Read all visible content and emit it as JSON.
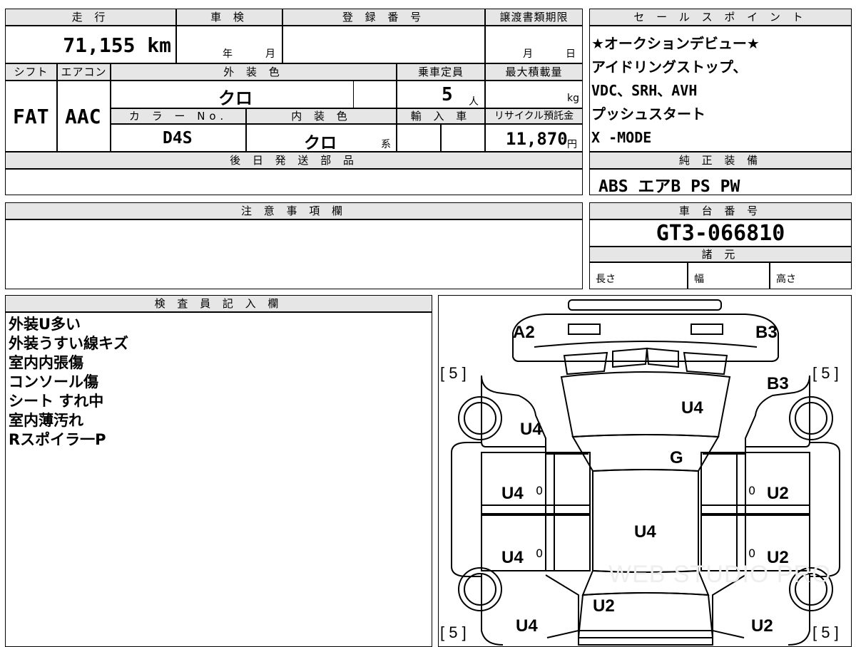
{
  "top": {
    "mileage_header": "走 行",
    "mileage_value": "71,155 km",
    "inspection_header": "車 検",
    "inspection_year": "年",
    "inspection_month": "月",
    "registration_header": "登 録 番 号",
    "transfer_header": "譲渡書類期限",
    "transfer_month": "月",
    "transfer_day": "日",
    "shift_header": "シフト",
    "shift_value": "FAT",
    "ac_header": "エアコン",
    "ac_value": "AAC",
    "exterior_color_header": "外 装 色",
    "exterior_color_value": "クロ",
    "capacity_header": "乗車定員",
    "capacity_value": "5",
    "capacity_unit": "人",
    "max_load_header": "最大積載量",
    "max_load_unit": "kg",
    "color_no_header": "カ ラ ー No.",
    "color_no_value": "D4S",
    "interior_color_header": "内 装 色",
    "interior_color_value": "クロ",
    "interior_color_suffix": "系",
    "import_header": "輸 入 車",
    "recycle_header": "リサイクル預託金",
    "recycle_value": "11,870",
    "recycle_unit": "円",
    "later_parts_header": "後 日 発 送 部 品"
  },
  "sales_points": {
    "header": "セ ー ル ス ポ イ ン ト",
    "lines": [
      "★オークションデビュー★",
      "アイドリングストップ、",
      "VDC、SRH、AVH",
      "プッシュスタート",
      "X -MODE"
    ]
  },
  "genuine_equipment": {
    "header": "純 正 装 備",
    "value": "ABS エアB PS PW"
  },
  "caution": {
    "header": "注 意 事 項 欄"
  },
  "chassis": {
    "header": "車 台 番 号",
    "value": "GT3-066810"
  },
  "specs": {
    "header": "諸 元",
    "length": "長さ",
    "width": "幅",
    "height": "高さ"
  },
  "inspector": {
    "header": "検 査 員 記 入 欄",
    "lines": [
      "外装U多い",
      "外装うすい線キズ",
      "室内内張傷",
      "コンソール傷",
      "シート すれ中",
      "室内薄汚れ",
      "Rスポイラ一P"
    ]
  },
  "diagram": {
    "labels": {
      "front_left_corner": "A2",
      "front_right_corner": "B3",
      "right_front_fender": "B3",
      "hood": "U4",
      "left_front_fender": "U4",
      "windshield": "G",
      "left_front_door": "U4",
      "right_front_door": "U2",
      "roof": "U4",
      "left_rear_door": "U4",
      "right_rear_door": "U2",
      "trunk": "U2",
      "left_rear_quarter": "U4",
      "right_rear_quarter": "U2"
    },
    "tire_top_left": "[ 5 ]",
    "tire_top_right": "[ 5 ]",
    "tire_bottom_left": "[ 5 ]",
    "tire_bottom_right": "[ 5 ]",
    "door_mark": "0",
    "watermark": "WEB STUDIO PRO"
  }
}
